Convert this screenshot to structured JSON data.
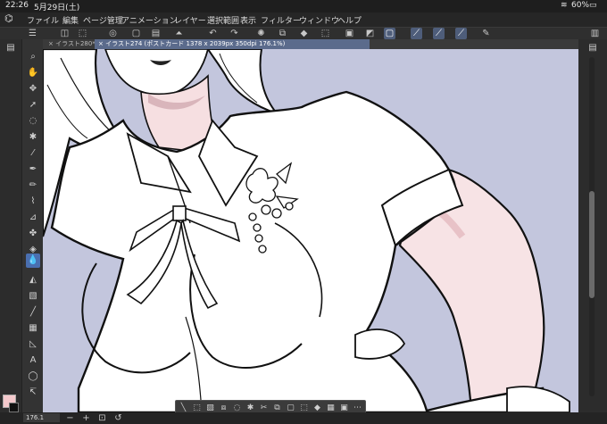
{
  "status": {
    "time": "22:26",
    "date": "5月29日(土)",
    "battery": "60%"
  },
  "menu": [
    "ファイル",
    "編集",
    "ページ管理",
    "アニメーション",
    "レイヤー",
    "選択範囲",
    "表示",
    "フィルター",
    "ウィンドウ",
    "ヘルプ"
  ],
  "tabs": [
    {
      "label": "× イラスト280*"
    },
    {
      "label": "× イラスト274 (ポストカード 1378 x 2039px 350dpi 176.1%)"
    }
  ],
  "zoom": "176.1",
  "colors": {
    "main": "#f4c9cc",
    "sub": "#111111",
    "canvas_bg": "#c3c6dd",
    "accent": "#4a6fb0"
  },
  "icons": {
    "command_bar": [
      "menu-icon",
      "new-icon",
      "open-icon",
      "save-icon",
      "undo-icon",
      "redo-icon",
      "clear-icon",
      "transform-icon",
      "fill-icon",
      "select-icon",
      "layer-icon",
      "snap-icon",
      "ruler-icon",
      "edit-icon"
    ],
    "tools": [
      "magnifier-icon",
      "hand-icon",
      "move-icon",
      "object-icon",
      "lasso-icon",
      "wand-icon",
      "eyedropper-icon",
      "pen-icon",
      "pencil-icon",
      "brush-icon",
      "airbrush-icon",
      "decoration-icon",
      "eraser-icon",
      "blend-icon",
      "fill-bucket-icon",
      "gradient-icon",
      "figure-icon",
      "frame-icon",
      "ruler-icon",
      "text-icon",
      "balloon-icon",
      "line-correct-icon"
    ]
  }
}
